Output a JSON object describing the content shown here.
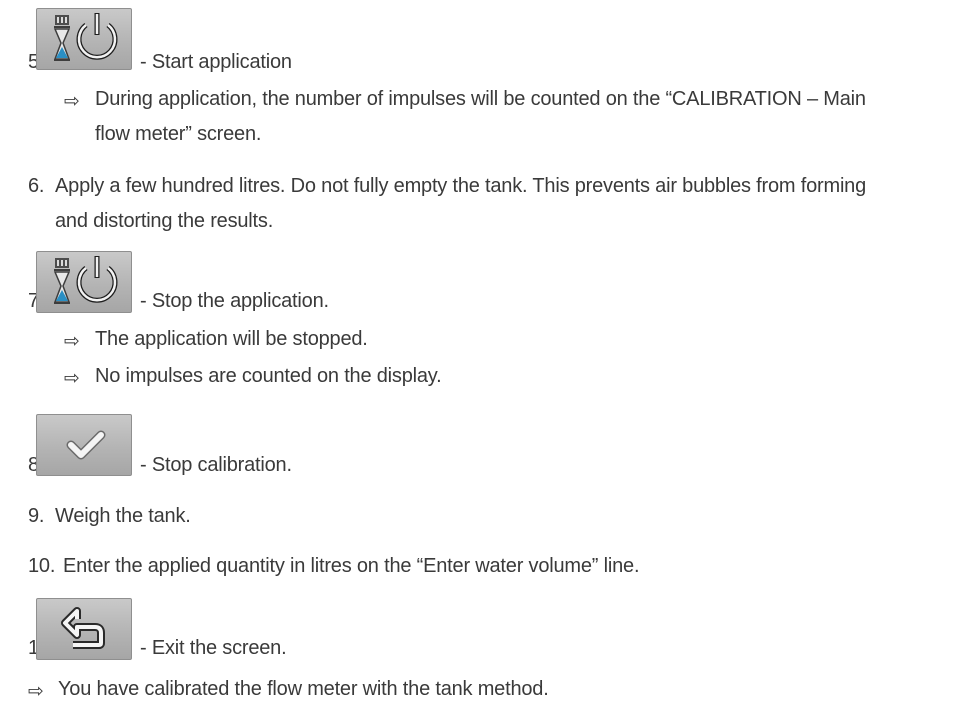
{
  "steps": [
    {
      "number": "5.",
      "text": "- Start application",
      "icon": "application-start-stop-icon"
    },
    {
      "arrow": "⇨",
      "text": "During application, the number of impulses will be counted on the “CALIBRATION – Main"
    },
    {
      "text": "flow meter” screen."
    },
    {
      "number": "6.",
      "text": "Apply a few hundred litres. Do not fully empty the tank. This prevents air bubbles from forming"
    },
    {
      "text": "and distorting the results."
    },
    {
      "number": "7.",
      "text": "- Stop the application.",
      "icon": "application-start-stop-icon"
    },
    {
      "arrow": "⇨",
      "text": "The application will be stopped."
    },
    {
      "arrow": "⇨",
      "text": "No impulses are counted on the display."
    },
    {
      "number": "8.",
      "text": "- Stop calibration.",
      "icon": "checkmark-icon"
    },
    {
      "number": "9.",
      "text": "Weigh the tank."
    },
    {
      "number": "10.",
      "text": "Enter the applied quantity in litres on the “Enter water volume” line."
    },
    {
      "number": "11.",
      "text": "- Exit the screen.",
      "icon": "return-arrow-icon"
    },
    {
      "arrow": "⇨",
      "text": "You have calibrated the flow meter with the tank method."
    }
  ],
  "colors": {
    "text": "#3a3a3a",
    "icon_bg": "#b9b9b9",
    "icon_accent": "#2a8fc4"
  }
}
